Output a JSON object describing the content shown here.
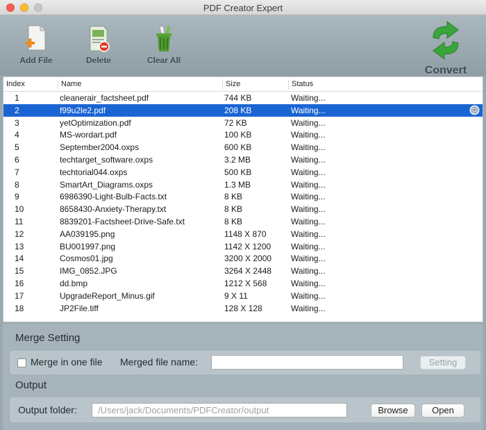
{
  "window": {
    "title": "PDF Creator Expert"
  },
  "toolbar": {
    "add_label": "Add File",
    "delete_label": "Delete",
    "clear_label": "Clear All",
    "convert_label": "Convert"
  },
  "table": {
    "headers": {
      "index": "Index",
      "name": "Name",
      "size": "Size",
      "status": "Status"
    },
    "rows": [
      {
        "index": "1",
        "name": "cleanerair_factsheet.pdf",
        "size": "744 KB",
        "status": "Waiting..."
      },
      {
        "index": "2",
        "name": "f99u2le2.pdf",
        "size": "208 KB",
        "status": "Waiting..."
      },
      {
        "index": "3",
        "name": "yetOptimization.pdf",
        "size": "72 KB",
        "status": "Waiting..."
      },
      {
        "index": "4",
        "name": "MS-wordart.pdf",
        "size": "100 KB",
        "status": "Waiting..."
      },
      {
        "index": "5",
        "name": "September2004.oxps",
        "size": "600 KB",
        "status": "Waiting..."
      },
      {
        "index": "6",
        "name": "techtarget_software.oxps",
        "size": "3.2 MB",
        "status": "Waiting..."
      },
      {
        "index": "7",
        "name": "techtorial044.oxps",
        "size": "500 KB",
        "status": "Waiting..."
      },
      {
        "index": "8",
        "name": "SmartArt_Diagrams.oxps",
        "size": "1.3 MB",
        "status": "Waiting..."
      },
      {
        "index": "9",
        "name": "6986390-Light-Bulb-Facts.txt",
        "size": "8 KB",
        "status": "Waiting..."
      },
      {
        "index": "10",
        "name": "8658430-Anxiety-Therapy.txt",
        "size": "8 KB",
        "status": "Waiting..."
      },
      {
        "index": "11",
        "name": "8839201-Factsheet-Drive-Safe.txt",
        "size": "8 KB",
        "status": "Waiting..."
      },
      {
        "index": "12",
        "name": "AA039195.png",
        "size": "1148 X 870",
        "status": "Waiting..."
      },
      {
        "index": "13",
        "name": "BU001997.png",
        "size": "1142 X 1200",
        "status": "Waiting..."
      },
      {
        "index": "14",
        "name": "Cosmos01.jpg",
        "size": "3200 X 2000",
        "status": "Waiting..."
      },
      {
        "index": "15",
        "name": "IMG_0852.JPG",
        "size": "3264 X 2448",
        "status": "Waiting..."
      },
      {
        "index": "16",
        "name": "dd.bmp",
        "size": "1212 X 568",
        "status": "Waiting..."
      },
      {
        "index": "17",
        "name": "UpgradeReport_Minus.gif",
        "size": "9 X 11",
        "status": "Waiting..."
      },
      {
        "index": "18",
        "name": "JP2File.tiff",
        "size": "128 X 128",
        "status": "Waiting..."
      }
    ],
    "selected_index": 2,
    "selected_row_icon": "gear-icon"
  },
  "merge": {
    "section_title": "Merge Setting",
    "checkbox_label": "Merge in one file",
    "checkbox_checked": false,
    "file_name_label": "Merged file name:",
    "file_name_value": "",
    "setting_button": "Setting"
  },
  "output": {
    "section_title": "Output",
    "folder_label": "Output folder:",
    "folder_placeholder": "/Users/jack/Documents/PDFCreator/output",
    "browse_button": "Browse",
    "open_button": "Open"
  },
  "colors": {
    "selection": "#1a64d3",
    "panel": "#a6b3ba",
    "convert_green": "#3aa53a"
  }
}
